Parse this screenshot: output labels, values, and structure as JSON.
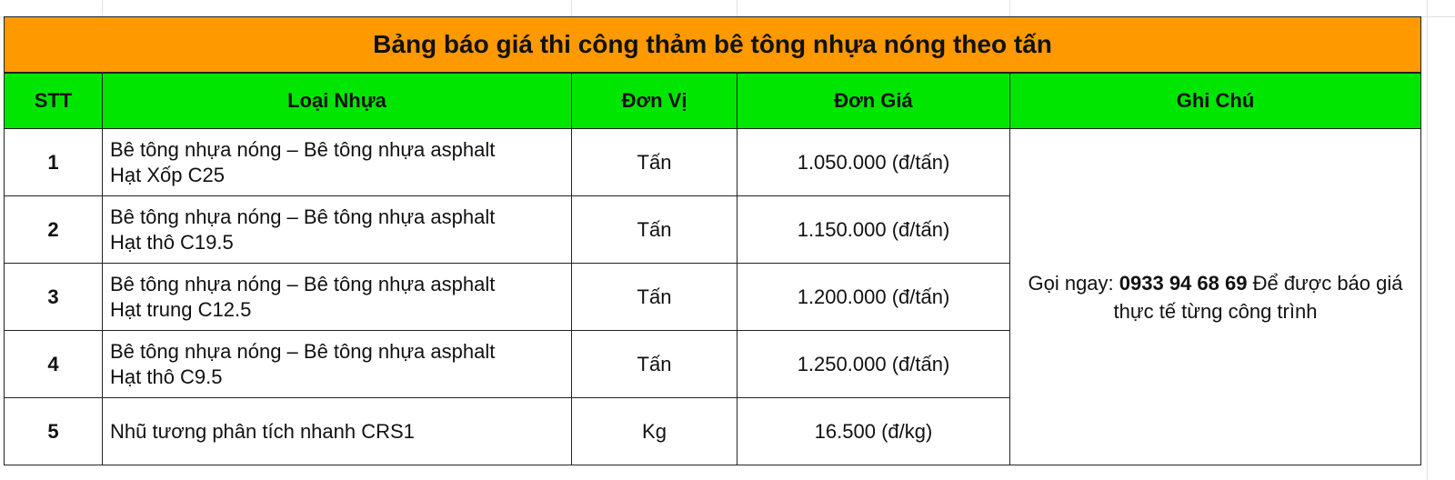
{
  "table": {
    "title": "Bảng báo giá thi công thảm bê tông nhựa nóng theo tấn",
    "headers": {
      "stt": "STT",
      "type": "Loại Nhựa",
      "unit": "Đơn Vị",
      "price": "Đơn Giá",
      "note": "Ghi Chú"
    },
    "rows": [
      {
        "stt": "1",
        "line1": "Bê tông nhựa nóng – Bê tông nhựa asphalt",
        "line2": "Hạt Xốp C25",
        "unit": "Tấn",
        "price": "1.050.000 (đ/tấn)"
      },
      {
        "stt": "2",
        "line1": "Bê tông nhựa nóng – Bê tông nhựa asphalt",
        "line2": "Hạt thô C19.5",
        "unit": "Tấn",
        "price": "1.150.000 (đ/tấn)"
      },
      {
        "stt": "3",
        "line1": "Bê tông nhựa nóng – Bê tông nhựa asphalt",
        "line2": "Hạt trung C12.5",
        "unit": "Tấn",
        "price": "1.200.000 (đ/tấn)"
      },
      {
        "stt": "4",
        "line1": "Bê tông nhựa nóng – Bê tông nhựa asphalt",
        "line2": "Hạt thô C9.5",
        "unit": "Tấn",
        "price": "1.250.000 (đ/tấn)"
      },
      {
        "stt": "5",
        "line1": "Nhũ tương phân tích nhanh CRS1",
        "line2": "",
        "unit": "Kg",
        "price": "16.500 (đ/kg)"
      }
    ],
    "note": {
      "prefix": "Gọi ngay: ",
      "phone": "0933 94 68 69",
      "suffix": " Để được báo giá thực tế từng công trình"
    }
  },
  "colors": {
    "title_bg": "#ff9900",
    "header_bg": "#00e600",
    "border": "#222222"
  }
}
